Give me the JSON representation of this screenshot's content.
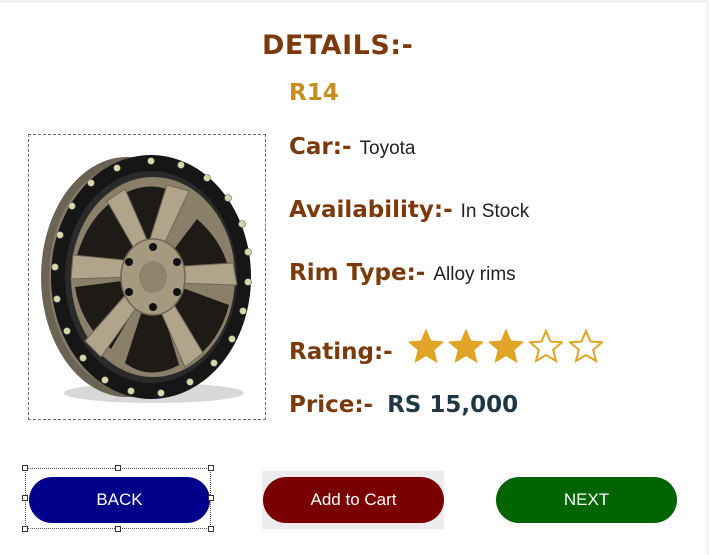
{
  "header": {
    "title": "DETAILS:-",
    "size": "R14"
  },
  "product": {
    "image_alt_icon": "wheel-rim-image",
    "car_label": "Car:-",
    "car_value": "Toyota",
    "availability_label": "Availability:-",
    "availability_value": "In Stock",
    "rim_type_label": "Rim Type:-",
    "rim_type_value": "Alloy rims",
    "rating_label": "Rating:-",
    "rating_value": 3,
    "rating_max": 5,
    "price_label": "Price:-",
    "price_value": "RS 15,000"
  },
  "buttons": {
    "back": "BACK",
    "add_to_cart": "Add to Cart",
    "next": "NEXT"
  },
  "colors": {
    "label_brown": "#7a3a0c",
    "size_gold": "#c78d1f",
    "star_gold": "#e0a526",
    "back_blue": "#00008a",
    "cart_maroon": "#7a0000",
    "next_green": "#006400"
  }
}
